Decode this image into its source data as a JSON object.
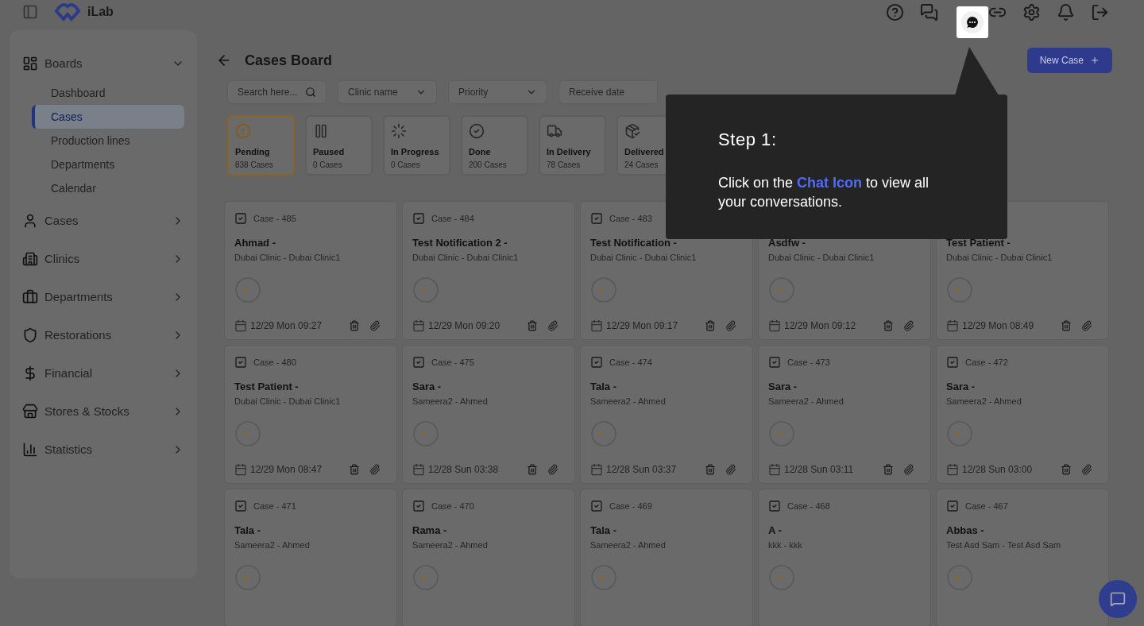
{
  "header": {
    "app_name": "iLab"
  },
  "sidebar": {
    "groups": [
      {
        "label": "Boards",
        "expanded": true,
        "children": [
          {
            "label": "Dashboard",
            "selected": false
          },
          {
            "label": "Cases",
            "selected": true
          },
          {
            "label": "Production lines",
            "selected": false
          },
          {
            "label": "Departments",
            "selected": false
          },
          {
            "label": "Calendar",
            "selected": false
          }
        ]
      },
      {
        "label": "Cases",
        "expanded": false
      },
      {
        "label": "Clinics",
        "expanded": false
      },
      {
        "label": "Departments",
        "expanded": false
      },
      {
        "label": "Restorations",
        "expanded": false
      },
      {
        "label": "Financial",
        "expanded": false
      },
      {
        "label": "Stores & Stocks",
        "expanded": false
      },
      {
        "label": "Statistics",
        "expanded": false
      }
    ]
  },
  "page": {
    "title": "Cases Board",
    "new_button": "New Case"
  },
  "filters": [
    {
      "kind": "search",
      "placeholder": "Search here..."
    },
    {
      "kind": "select",
      "placeholder": "Clinic name"
    },
    {
      "kind": "select",
      "placeholder": "Priority"
    },
    {
      "kind": "date",
      "placeholder": "Receive date"
    }
  ],
  "statuses": [
    {
      "label": "Pending",
      "count": "838 Cases",
      "selected": true
    },
    {
      "label": "Paused",
      "count": "0 Cases",
      "selected": false
    },
    {
      "label": "In Progress",
      "count": "0 Cases",
      "selected": false
    },
    {
      "label": "Done",
      "count": "200 Cases",
      "selected": false
    },
    {
      "label": "In Delivery",
      "count": "78 Cases",
      "selected": false
    },
    {
      "label": "Delivered",
      "count": "24 Cases",
      "selected": false
    }
  ],
  "cases": [
    {
      "case": "Case - 485",
      "name": "Ahmad -",
      "clinic": "Dubai Clinic - Dubai Clinic1",
      "date": "12/29 Mon 09:27"
    },
    {
      "case": "Case - 484",
      "name": "Test Notification 2 -",
      "clinic": "Dubai Clinic - Dubai Clinic1",
      "date": "12/29 Mon 09:20"
    },
    {
      "case": "Case - 483",
      "name": "Test Notification -",
      "clinic": "Dubai Clinic - Dubai Clinic1",
      "date": "12/29 Mon 09:17"
    },
    {
      "name": "Asdfw -",
      "clinic": "Dubai Clinic - Dubai Clinic1",
      "date": "12/29 Mon 09:12"
    },
    {
      "name": "Test Patient -",
      "clinic": "Dubai Clinic - Dubai Clinic1",
      "date": "12/29 Mon 08:49"
    },
    {
      "case": "Case - 480",
      "name": "Test Patient -",
      "clinic": "Dubai Clinic - Dubai Clinic1",
      "date": "12/29 Mon 08:47"
    },
    {
      "case": "Case - 475",
      "name": "Sara -",
      "clinic": "Sameera2 - Ahmed",
      "date": "12/28 Sun 03:38"
    },
    {
      "case": "Case - 474",
      "name": "Tala -",
      "clinic": "Sameera2 - Ahmed",
      "date": "12/28 Sun 03:37"
    },
    {
      "case": "Case - 473",
      "name": "Sara -",
      "clinic": "Sameera2 - Ahmed",
      "date": "12/28 Sun 03:11"
    },
    {
      "case": "Case - 472",
      "name": "Sara -",
      "clinic": "Sameera2 - Ahmed",
      "date": "12/28 Sun 03:00"
    },
    {
      "case": "Case - 471",
      "name": "Tala -",
      "clinic": "Sameera2 - Ahmed"
    },
    {
      "case": "Case - 470",
      "name": "Rama -",
      "clinic": "Sameera2 - Ahmed"
    },
    {
      "case": "Case - 469",
      "name": "Tala -",
      "clinic": "Sameera2 - Ahmed"
    },
    {
      "case": "Case - 468",
      "name": "A -",
      "clinic": "kkk - kkk"
    },
    {
      "case": "Case - 467",
      "name": "Abbas -",
      "clinic": "Test Asd Sam - Test Asd Sam"
    }
  ],
  "tour": {
    "title": "Step 1:",
    "text": "Click on the **Chat Icon** to view all your conversations."
  }
}
